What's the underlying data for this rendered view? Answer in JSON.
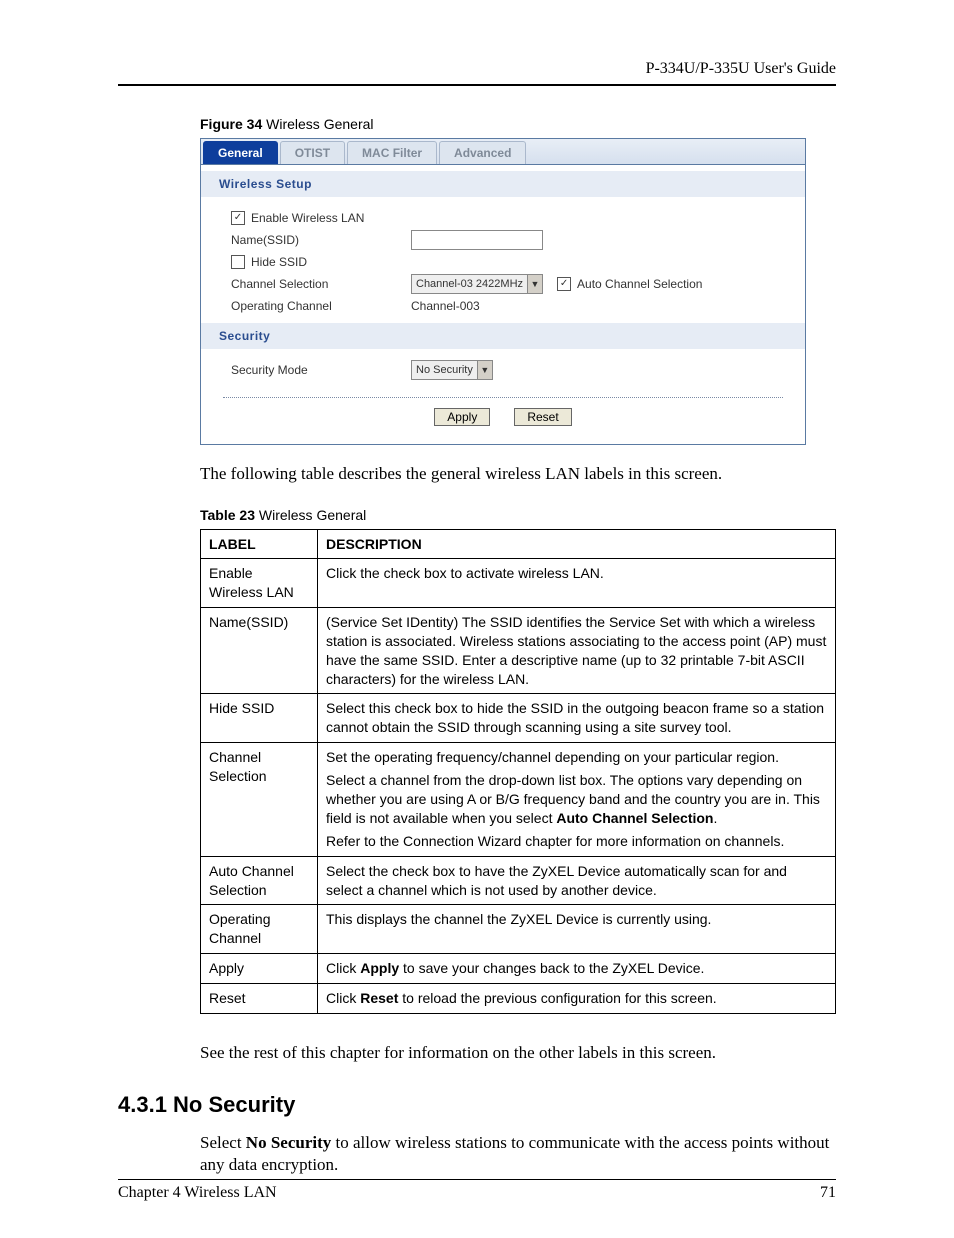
{
  "header": {
    "title": "P-334U/P-335U User's Guide"
  },
  "figure_caption": {
    "label": "Figure 34",
    "text": "   Wireless General"
  },
  "screenshot": {
    "tabs": [
      "General",
      "OTIST",
      "MAC Filter",
      "Advanced"
    ],
    "section1": "Wireless Setup",
    "enable_label": "Enable Wireless LAN",
    "enable_checked": "✓",
    "name_label": "Name(SSID)",
    "name_value": "",
    "hide_label": "Hide SSID",
    "hide_checked": "",
    "channel_sel_label": "Channel Selection",
    "channel_sel_value": "Channel-03 2422MHz",
    "auto_channel_label": "Auto Channel Selection",
    "auto_channel_checked": "✓",
    "operating_label": "Operating Channel",
    "operating_value": "Channel-003",
    "section2": "Security",
    "security_mode_label": "Security Mode",
    "security_mode_value": "No Security",
    "apply_btn": "Apply",
    "reset_btn": "Reset"
  },
  "intro_para": "The following table describes the general wireless LAN labels in this screen.",
  "table_caption": {
    "label": "Table 23",
    "text": "   Wireless General"
  },
  "table": {
    "th1": "LABEL",
    "th2": "DESCRIPTION",
    "rows": [
      {
        "label": "Enable Wireless LAN",
        "desc": [
          {
            "pre": "Click the check box to activate wireless LAN."
          }
        ]
      },
      {
        "label": "Name(SSID)",
        "desc": [
          {
            "pre": "(Service Set IDentity) The SSID identifies the Service Set with which a wireless station is associated. Wireless stations associating to the access point (AP) must have the same SSID. Enter a descriptive name (up to 32 printable 7-bit ASCII characters) for the wireless LAN."
          }
        ]
      },
      {
        "label": "Hide SSID",
        "desc": [
          {
            "pre": "Select this check box to hide the SSID in the outgoing beacon frame so a station cannot obtain the SSID through scanning using a site survey tool."
          }
        ]
      },
      {
        "label": "Channel Selection",
        "desc": [
          {
            "pre": "Set the operating frequency/channel depending on your particular region."
          },
          {
            "pre": "Select a channel from the drop-down list box. The options vary depending on whether you are using A or B/G frequency band and the country you are in. This field is not available when you select ",
            "bold": "Auto Channel Selection",
            "post": "."
          },
          {
            "pre": "Refer to the Connection Wizard chapter for more information on channels."
          }
        ]
      },
      {
        "label": "Auto Channel Selection",
        "desc": [
          {
            "pre": "Select the check box to have the ZyXEL Device automatically scan for and select a channel which is not used by another device."
          }
        ]
      },
      {
        "label": "Operating Channel",
        "desc": [
          {
            "pre": "This displays the channel the ZyXEL Device is currently using."
          }
        ]
      },
      {
        "label": "Apply",
        "desc": [
          {
            "pre": "Click ",
            "bold": "Apply",
            "post": " to save your changes back to the ZyXEL Device."
          }
        ]
      },
      {
        "label": "Reset",
        "desc": [
          {
            "pre": "Click ",
            "bold": "Reset",
            "post": " to reload the previous configuration for this screen."
          }
        ]
      }
    ]
  },
  "after_table_para": "See the rest of this chapter for information on the other labels in this screen.",
  "section_heading": "4.3.1  No Security",
  "nosec_para": {
    "pre": "Select ",
    "bold": "No Security",
    "post": " to allow wireless stations to communicate with the access points without any data encryption."
  },
  "footer": {
    "left": "Chapter 4 Wireless LAN",
    "right": "71"
  }
}
